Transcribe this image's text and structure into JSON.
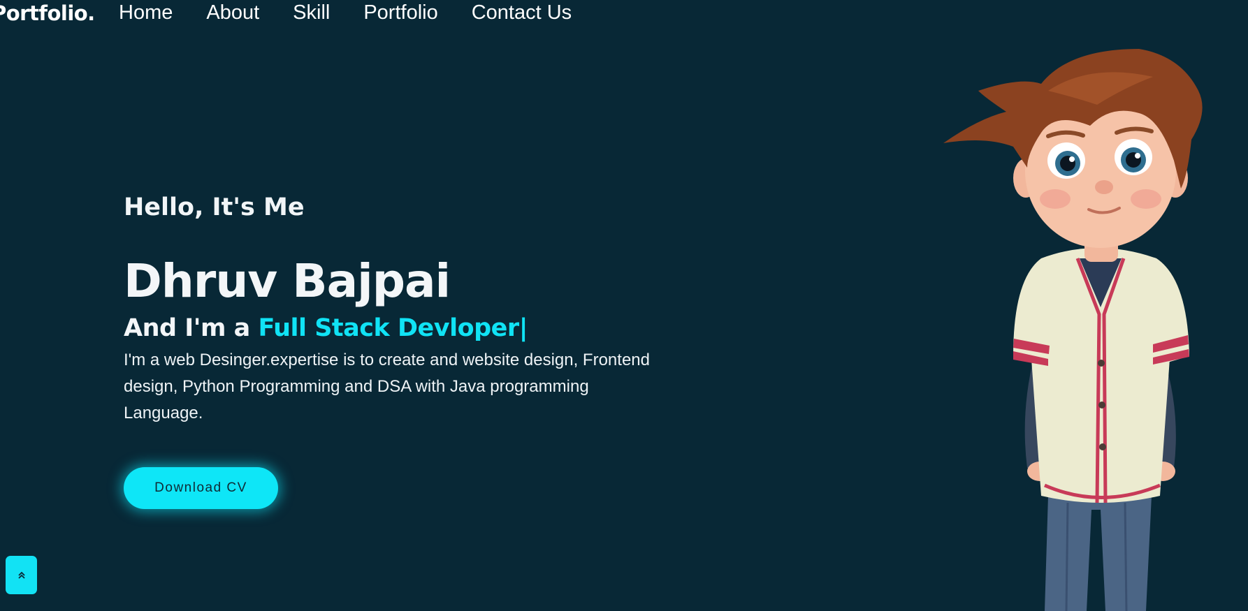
{
  "header": {
    "logo": "Portfolio.",
    "nav": [
      "Home",
      "About",
      "Skill",
      "Portfolio",
      "Contact Us"
    ]
  },
  "hero": {
    "greeting": "Hello, It's Me",
    "name": "Dhruv Bajpai",
    "role_prefix": "And I'm a ",
    "role_highlight": "Full Stack Devloper",
    "caret": "|",
    "description": "I'm a web Desinger.expertise is to create and website design, Frontend design, Python Programming and DSA with Java programming Language.",
    "cv_button": "Download CV"
  },
  "back_to_top": {
    "icon": "double-chevron-up-icon"
  },
  "colors": {
    "background": "#082836",
    "accent": "#0ee6f7",
    "text": "#f3f6f8"
  }
}
